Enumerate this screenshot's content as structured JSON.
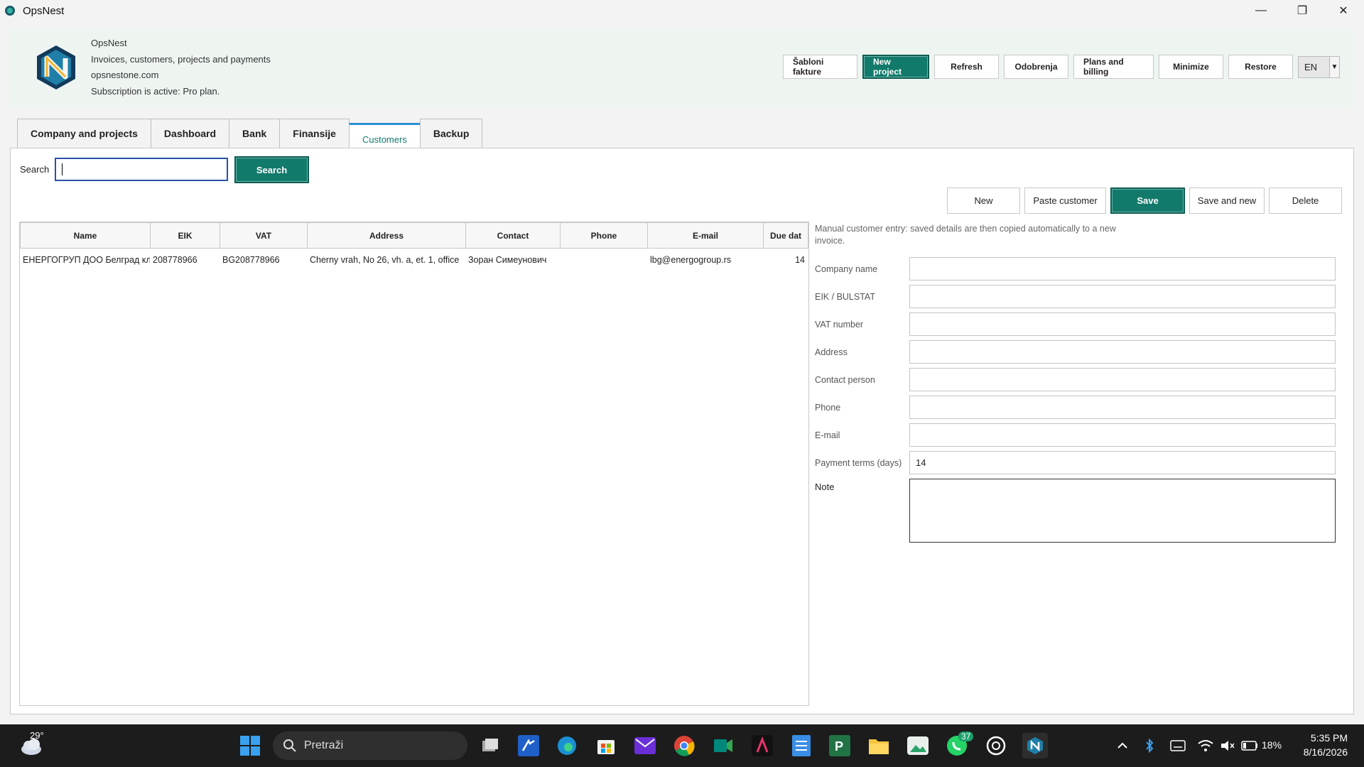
{
  "window": {
    "title": "OpsNest"
  },
  "header": {
    "app_name": "OpsNest",
    "tagline": "Invoices, customers, projects and payments",
    "website": "opsnestone.com",
    "subscription": "Subscription is active: Pro plan.",
    "buttons": {
      "templates": "Šabloni fakture",
      "new_project": "New project",
      "refresh": "Refresh",
      "approvals": "Odobrenja",
      "plans": "Plans and billing",
      "minimize": "Minimize",
      "restore": "Restore"
    },
    "language": "EN"
  },
  "tabs": [
    "Company and projects",
    "Dashboard",
    "Bank",
    "Finansije",
    "Customers",
    "Backup"
  ],
  "search": {
    "label": "Search",
    "button": "Search",
    "value": ""
  },
  "table": {
    "columns": [
      "Name",
      "EIK",
      "VAT",
      "Address",
      "Contact",
      "Phone",
      "E-mail",
      "Due dat"
    ],
    "rows": [
      {
        "name": "ЕНЕРГОГРУП ДОО Белград кл",
        "eik": "208778966",
        "vat": "BG208778966",
        "address": "Cherny vrah, No 26, vh. a, et. 1, office",
        "contact": "Зоран Симеунович",
        "phone": "",
        "email": "lbg@energogroup.rs",
        "due": "14"
      }
    ]
  },
  "form": {
    "buttons": {
      "new": "New",
      "paste": "Paste customer",
      "save": "Save",
      "save_new": "Save and new",
      "delete": "Delete"
    },
    "note": "Manual customer entry: saved details are then copied automatically to a new invoice.",
    "fields": {
      "company_name": {
        "label": "Company name",
        "value": ""
      },
      "eik": {
        "label": "EIK / BULSTAT",
        "value": ""
      },
      "vat": {
        "label": "VAT number",
        "value": ""
      },
      "address": {
        "label": "Address",
        "value": ""
      },
      "contact": {
        "label": "Contact person",
        "value": ""
      },
      "phone": {
        "label": "Phone",
        "value": ""
      },
      "email": {
        "label": "E-mail",
        "value": ""
      },
      "payment_terms": {
        "label": "Payment terms (days)",
        "value": "14"
      }
    },
    "note_label": "Note"
  },
  "taskbar": {
    "weather": "29°",
    "search_placeholder": "Pretraži",
    "whatsapp_badge": "37",
    "battery": "18%",
    "time": "5:35 PM",
    "date": "8/16/2026"
  },
  "colors": {
    "accent": "#127a6b",
    "header_bg": "#eef5f1",
    "taskbar": "#1c1c1c"
  }
}
